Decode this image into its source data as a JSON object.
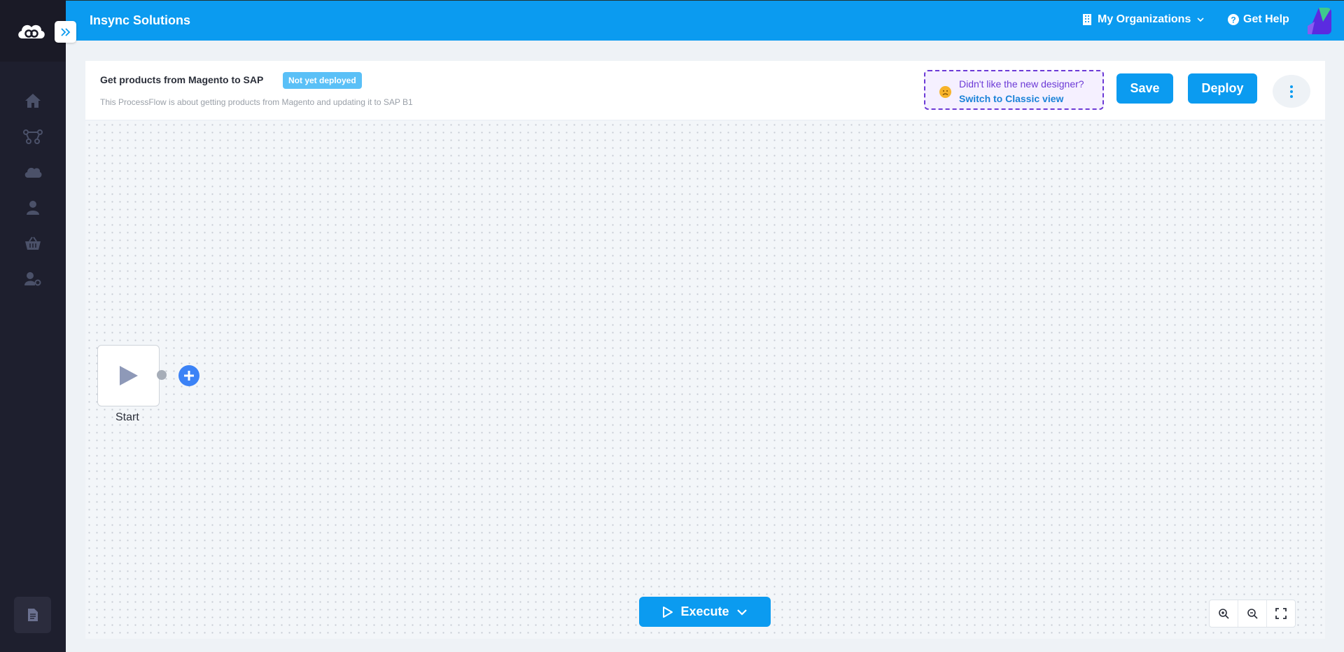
{
  "header": {
    "brand": "Insync Solutions",
    "org_label": "My Organizations",
    "help_label": "Get Help"
  },
  "sidebar": {
    "items": [
      {
        "icon": "home-icon"
      },
      {
        "icon": "process-flow-icon"
      },
      {
        "icon": "cloud-icon"
      },
      {
        "icon": "user-icon"
      },
      {
        "icon": "basket-icon"
      },
      {
        "icon": "user-settings-icon"
      }
    ],
    "bottom_icon": "document-icon"
  },
  "flow": {
    "title": "Get products from Magento to SAP",
    "status": "Not yet deployed",
    "description": "This ProcessFlow is about getting products from Magento and updating it to SAP B1"
  },
  "classic_prompt": {
    "question": "Didn't like the new designer?",
    "link": "Switch to Classic view"
  },
  "actions": {
    "save": "Save",
    "deploy": "Deploy"
  },
  "canvas": {
    "start_label": "Start",
    "execute_label": "Execute"
  },
  "colors": {
    "primary": "#0b9bf0",
    "sidebar": "#1e1f2e",
    "accent_purple": "#6c3ad6",
    "badge": "#5ac0f7"
  }
}
